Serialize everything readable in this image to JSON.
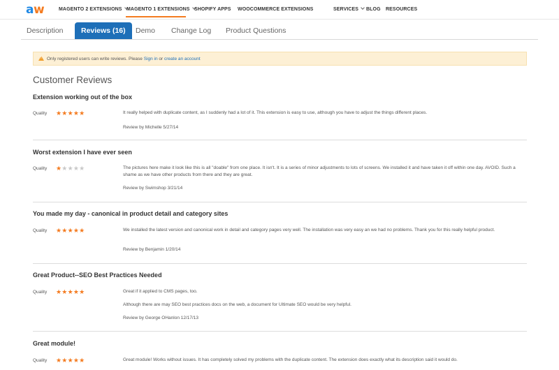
{
  "logo": {
    "a": "a",
    "w": "w"
  },
  "nav": {
    "items": [
      {
        "label": "MAGENTO 2 EXTENSIONS",
        "has_dropdown": true
      },
      {
        "label": "MAGENTO 1 EXTENSIONS",
        "has_dropdown": true,
        "active": true
      },
      {
        "label": "SHOPIFY APPS",
        "has_dropdown": false
      },
      {
        "label": "WOOCOMMERCE EXTENSIONS",
        "has_dropdown": false
      },
      {
        "label": "SERVICES",
        "has_dropdown": true
      },
      {
        "label": "BLOG",
        "has_dropdown": false
      },
      {
        "label": "RESOURCES",
        "has_dropdown": false
      }
    ],
    "accent_color": "#f47b20"
  },
  "tabs": [
    {
      "label": "Description"
    },
    {
      "label": "Reviews (16)",
      "active": true
    },
    {
      "label": "Demo"
    },
    {
      "label": "Change Log"
    },
    {
      "label": "Product Questions"
    }
  ],
  "notice": {
    "prefix": "Only registered users can write reviews. Please ",
    "sign_in": "Sign in",
    "middle": " or ",
    "create_account": "create an account"
  },
  "reviews_section": {
    "title": "Customer Reviews",
    "quality_label": "Quality",
    "star_color": "#f47b20",
    "items": [
      {
        "title": "Extension working out of the box",
        "rating": 5,
        "paragraphs": [
          "It really helped with duplicate content, as I suddenly had a lot of it. This extension is easy to use, although you have to adjust the things different places."
        ],
        "by": "Review by Michelle 5/27/14"
      },
      {
        "title": "Worst extension I have ever seen",
        "rating": 1,
        "paragraphs": [
          "The pictures here make it look like this is all \"doable\" from one place. It isn't. It is a series of minor adjustments to lots of screens. We installed it and have taken it off within one day. AVOID. Such a shame as we have other products from there and they are great."
        ],
        "by": "Review by Swimshop 3/21/14"
      },
      {
        "title": "You made my day - canonical in product detail and category sites",
        "rating": 5,
        "paragraphs": [
          "We installed the latest version and canonical work in detail and category pages very well. The installation was very easy an we had no problems. Thank you for this really helpful product."
        ],
        "by": "Review by Benjamin 1/20/14"
      },
      {
        "title": "Great Product--SEO Best Practices Needed",
        "rating": 5,
        "paragraphs": [
          "Great if it applied to CMS pages, too.",
          "Although there are may SEO best practices docs on the web, a document for Ultimate SEO would be very helpful."
        ],
        "by": "Review by George OHanlon 12/17/13"
      },
      {
        "title": "Great module!",
        "rating": 5,
        "paragraphs": [
          "Great module! Works without issues. It has completely solved my problems with the duplicate content. The extension does exactly what its description said it would do."
        ],
        "by": ""
      }
    ]
  }
}
